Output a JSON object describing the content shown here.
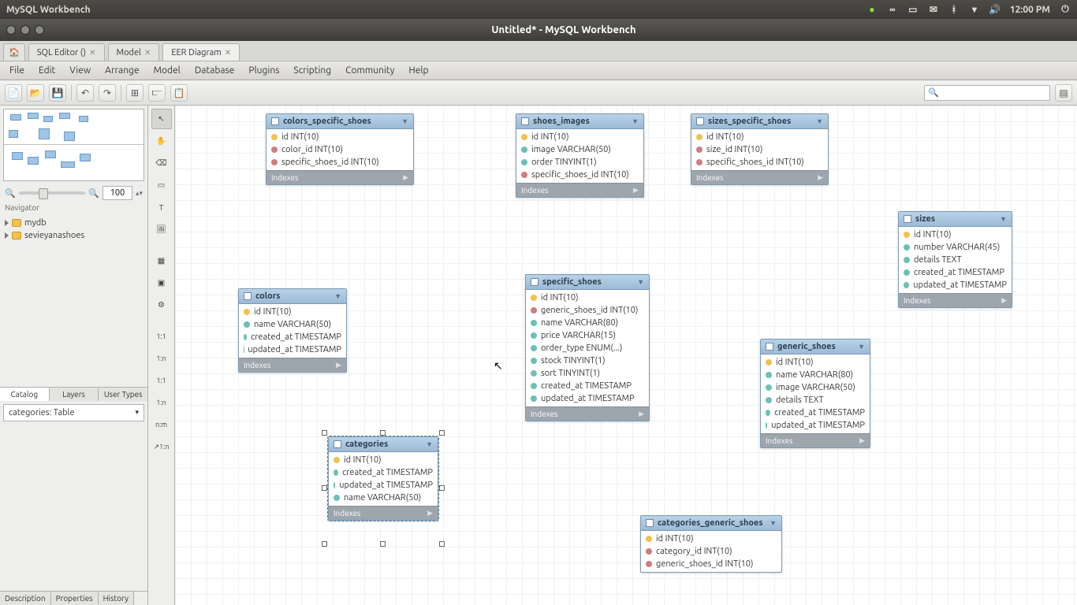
{
  "ubuntu": {
    "title": "MySQL Workbench",
    "time": "12:00 PM"
  },
  "window_title": "Untitled* - MySQL Workbench",
  "tabs": {
    "sql": "SQL Editor ()",
    "model": "Model",
    "eer": "EER Diagram"
  },
  "menu": [
    "File",
    "Edit",
    "View",
    "Arrange",
    "Model",
    "Database",
    "Plugins",
    "Scripting",
    "Community",
    "Help"
  ],
  "zoom_value": "100",
  "navigator_label": "Navigator",
  "schemas": [
    "mydb",
    "sevieyanashoes"
  ],
  "nav_tabs": [
    "Catalog",
    "Layers",
    "User Types"
  ],
  "combo_value": "categories: Table",
  "bottom_tabs": [
    "Description",
    "Properties",
    "History"
  ],
  "indexes_label": "Indexes",
  "entities": {
    "colors_specific_shoes": {
      "name": "colors_specific_shoes",
      "cols": [
        {
          "b": "b-key",
          "t": "id INT(10)"
        },
        {
          "b": "b-red",
          "t": "color_id INT(10)"
        },
        {
          "b": "b-red",
          "t": "specific_shoes_id INT(10)"
        }
      ]
    },
    "shoes_images": {
      "name": "shoes_images",
      "cols": [
        {
          "b": "b-key",
          "t": "id INT(10)"
        },
        {
          "b": "b-teal",
          "t": "image VARCHAR(50)"
        },
        {
          "b": "b-teal",
          "t": "order TINYINT(1)"
        },
        {
          "b": "b-red",
          "t": "specific_shoes_id INT(10)"
        }
      ]
    },
    "sizes_specific_shoes": {
      "name": "sizes_specific_shoes",
      "cols": [
        {
          "b": "b-key",
          "t": "id INT(10)"
        },
        {
          "b": "b-red",
          "t": "size_id INT(10)"
        },
        {
          "b": "b-red",
          "t": "specific_shoes_id INT(10)"
        }
      ]
    },
    "sizes": {
      "name": "sizes",
      "cols": [
        {
          "b": "b-key",
          "t": "id INT(10)"
        },
        {
          "b": "b-teal",
          "t": "number VARCHAR(45)"
        },
        {
          "b": "b-teal",
          "t": "details TEXT"
        },
        {
          "b": "b-teal",
          "t": "created_at TIMESTAMP"
        },
        {
          "b": "b-teal",
          "t": "updated_at TIMESTAMP"
        }
      ]
    },
    "colors": {
      "name": "colors",
      "cols": [
        {
          "b": "b-key",
          "t": "id INT(10)"
        },
        {
          "b": "b-teal",
          "t": "name VARCHAR(50)"
        },
        {
          "b": "b-teal",
          "t": "created_at TIMESTAMP"
        },
        {
          "b": "b-teal",
          "t": "updated_at TIMESTAMP"
        }
      ]
    },
    "specific_shoes": {
      "name": "specific_shoes",
      "cols": [
        {
          "b": "b-key",
          "t": "id INT(10)"
        },
        {
          "b": "b-red",
          "t": "generic_shoes_id INT(10)"
        },
        {
          "b": "b-teal",
          "t": "name VARCHAR(80)"
        },
        {
          "b": "b-teal",
          "t": "price VARCHAR(15)"
        },
        {
          "b": "b-teal",
          "t": "order_type ENUM(...)"
        },
        {
          "b": "b-teal",
          "t": "stock TINYINT(1)"
        },
        {
          "b": "b-teal",
          "t": "sort TINYINT(1)"
        },
        {
          "b": "b-teal",
          "t": "created_at TIMESTAMP"
        },
        {
          "b": "b-teal",
          "t": "updated_at TIMESTAMP"
        }
      ]
    },
    "generic_shoes": {
      "name": "generic_shoes",
      "cols": [
        {
          "b": "b-key",
          "t": "id INT(10)"
        },
        {
          "b": "b-teal",
          "t": "name VARCHAR(80)"
        },
        {
          "b": "b-teal",
          "t": "image VARCHAR(50)"
        },
        {
          "b": "b-teal",
          "t": "details TEXT"
        },
        {
          "b": "b-teal",
          "t": "created_at TIMESTAMP"
        },
        {
          "b": "b-teal",
          "t": "updated_at TIMESTAMP"
        }
      ]
    },
    "categories": {
      "name": "categories",
      "cols": [
        {
          "b": "b-key",
          "t": "id INT(10)"
        },
        {
          "b": "b-teal",
          "t": "created_at TIMESTAMP"
        },
        {
          "b": "b-teal",
          "t": "updated_at TIMESTAMP"
        },
        {
          "b": "b-teal",
          "t": "name VARCHAR(50)"
        }
      ]
    },
    "categories_generic_shoes": {
      "name": "categories_generic_shoes",
      "cols": [
        {
          "b": "b-key",
          "t": "id INT(10)"
        },
        {
          "b": "b-red",
          "t": "category_id INT(10)"
        },
        {
          "b": "b-red",
          "t": "generic_shoes_id INT(10)"
        }
      ]
    }
  }
}
